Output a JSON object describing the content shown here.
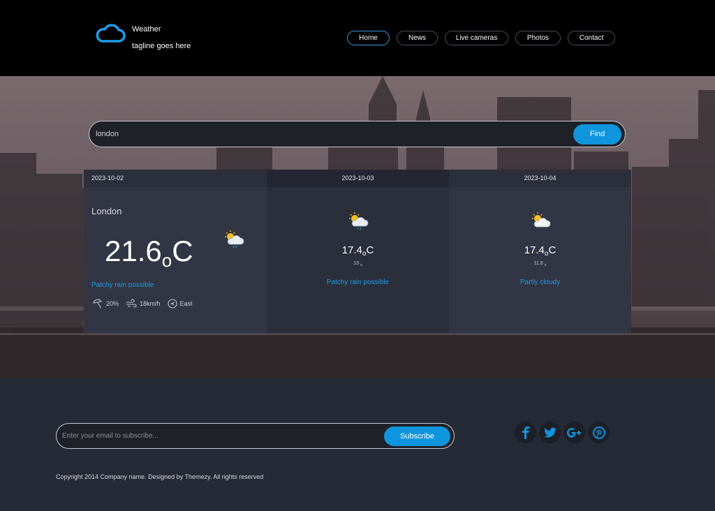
{
  "brand": {
    "title": "Weather",
    "tagline": "tagline goes here"
  },
  "nav": [
    {
      "label": "Home",
      "active": true
    },
    {
      "label": "News"
    },
    {
      "label": "Live cameras"
    },
    {
      "label": "Photos"
    },
    {
      "label": "Contact"
    }
  ],
  "search": {
    "value": "london",
    "button": "Find"
  },
  "forecast": {
    "today": {
      "date": "2023-10-02",
      "city": "London",
      "temp": "21.6",
      "deg_symbol": "o",
      "unit": "C",
      "icon": "patchy-rain-icon",
      "description": "Patchy rain possible",
      "precip": "20%",
      "wind": "18km/h",
      "direction": "East"
    },
    "days": [
      {
        "date": "2023-10-03",
        "temp": "17.4",
        "deg_symbol": "o",
        "unit": "C",
        "min": "13",
        "icon": "patchy-rain-icon",
        "description": "Patchy rain possible"
      },
      {
        "date": "2023-10-04",
        "temp": "17.4",
        "deg_symbol": "o",
        "unit": "C",
        "min": "11.9",
        "icon": "partly-cloudy-icon",
        "description": "Partly cloudy"
      }
    ]
  },
  "footer": {
    "subscribe_placeholder": "Enter your email to subscribe...",
    "subscribe_button": "Subscribe",
    "socials": [
      "facebook-icon",
      "twitter-icon",
      "google-plus-icon",
      "pinterest-icon"
    ],
    "copyright": "Copyright 2014 Company name. Designed by Themezy. All rights reserved"
  },
  "colors": {
    "accent": "#0f95dd",
    "header_bg": "#000000",
    "footer_bg": "#262936"
  }
}
